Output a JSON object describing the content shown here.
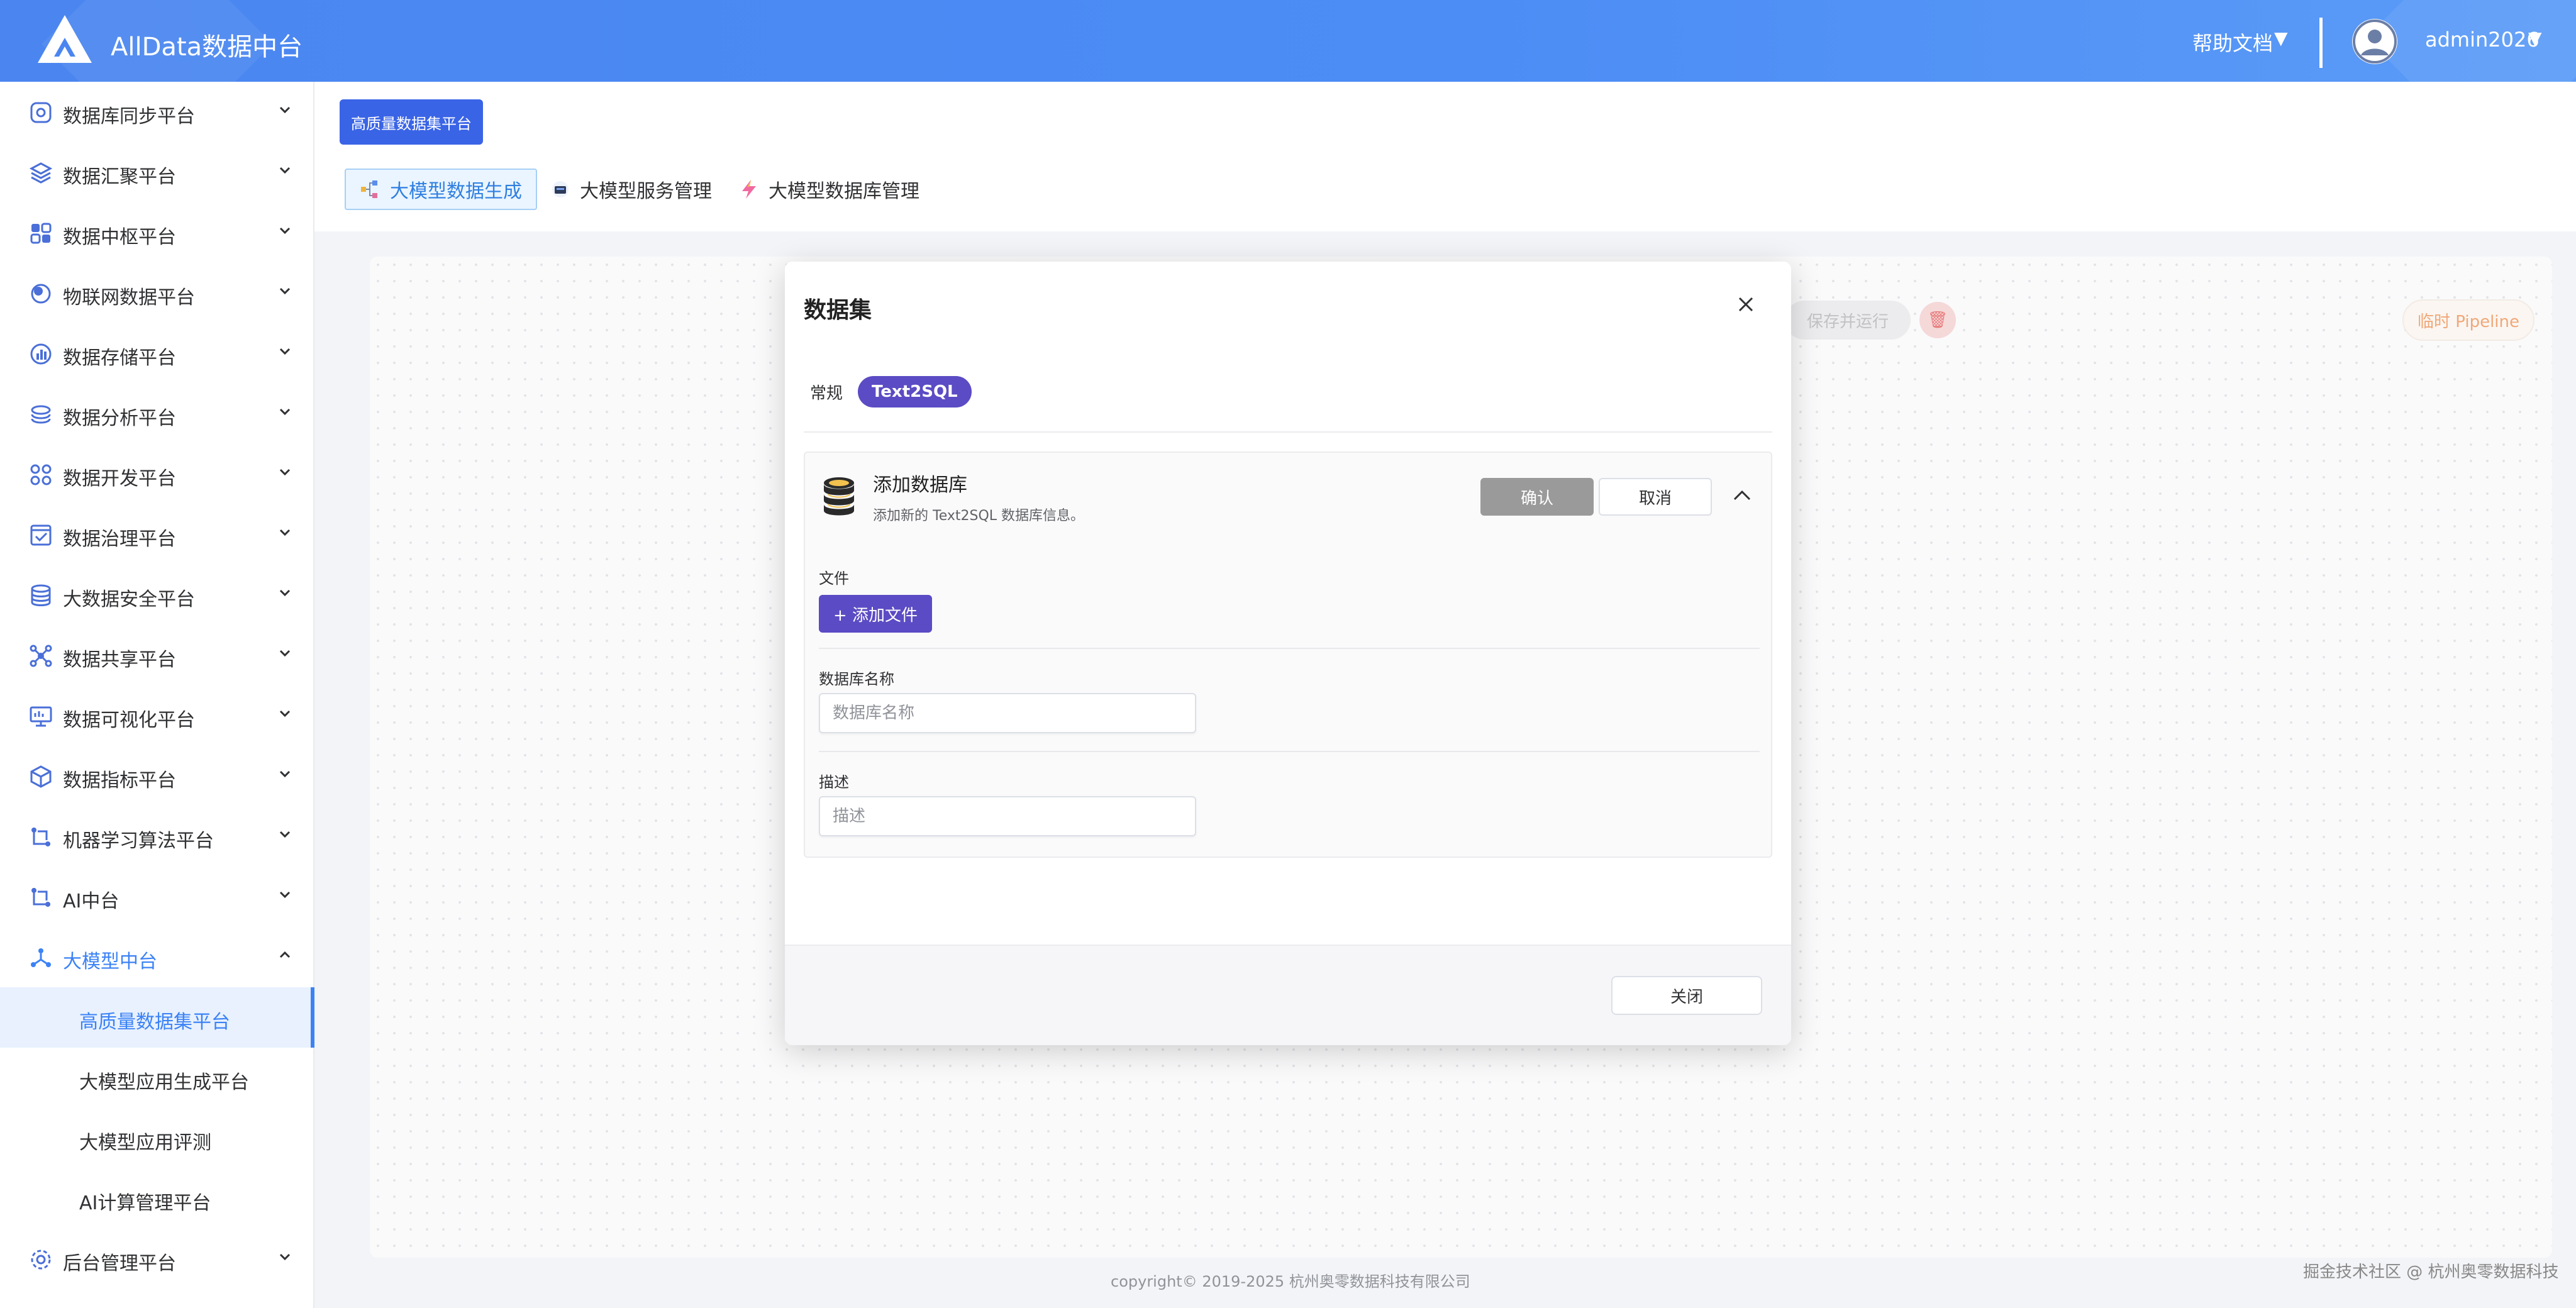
{
  "header": {
    "app_title": "AllData数据中台",
    "help_label": "帮助文档",
    "help_arrow": "▼",
    "username": "admin2026",
    "user_arrow": "▼"
  },
  "sidebar": {
    "items": [
      {
        "label": "数据库同步平台",
        "icon": "db-sync-icon"
      },
      {
        "label": "数据汇聚平台",
        "icon": "layers-icon"
      },
      {
        "label": "数据中枢平台",
        "icon": "grid-icon"
      },
      {
        "label": "物联网数据平台",
        "icon": "iot-icon"
      },
      {
        "label": "数据存储平台",
        "icon": "bar-chart-icon"
      },
      {
        "label": "数据分析平台",
        "icon": "analysis-icon"
      },
      {
        "label": "数据开发平台",
        "icon": "command-icon"
      },
      {
        "label": "数据治理平台",
        "icon": "checklist-icon"
      },
      {
        "label": "大数据安全平台",
        "icon": "database-icon"
      },
      {
        "label": "数据共享平台",
        "icon": "share-icon"
      },
      {
        "label": "数据可视化平台",
        "icon": "monitor-icon"
      },
      {
        "label": "数据指标平台",
        "icon": "cube-icon"
      },
      {
        "label": "机器学习算法平台",
        "icon": "ml-icon"
      },
      {
        "label": "AI中台",
        "icon": "ai-icon"
      },
      {
        "label": "大模型中台",
        "icon": "model-icon"
      }
    ],
    "sub_items": [
      {
        "label": "高质量数据集平台"
      },
      {
        "label": "大模型应用生成平台"
      },
      {
        "label": "大模型应用评测"
      },
      {
        "label": "AI计算管理平台"
      }
    ],
    "bottom_item": {
      "label": "后台管理平台",
      "icon": "settings-icon"
    }
  },
  "topbar": {
    "breadcrumb": "高质量数据集平台",
    "tabs": [
      {
        "label": "大模型数据生成",
        "icon": "flow-icon"
      },
      {
        "label": "大模型服务管理",
        "icon": "server-icon"
      },
      {
        "label": "大模型数据库管理",
        "icon": "lightning-icon"
      }
    ]
  },
  "canvas": {
    "save_run": "保存并运行",
    "trash_glyph": "🗑",
    "pipeline": "临时 Pipeline"
  },
  "modal": {
    "title": "数据集",
    "modes": [
      "常规",
      "Text2SQL"
    ],
    "card": {
      "title": "添加数据库",
      "subtitle": "添加新的 Text2SQL 数据库信息。",
      "confirm": "确认",
      "cancel": "取消",
      "file_label": "文件",
      "add_file": "+ 添加文件",
      "db_name_label": "数据库名称",
      "db_name_placeholder": "数据库名称",
      "desc_label": "描述",
      "desc_placeholder": "描述"
    },
    "close": "关闭"
  },
  "footer": {
    "copyright": "copyright© 2019-2025 杭州奥零数据科技有限公司",
    "watermark": "掘金技术社区 @ 杭州奥零数据科技"
  },
  "colors": {
    "header": "#4b86f0",
    "accent": "#3b82f6",
    "primary_purple": "#5b4bc4",
    "confirm_gray": "#9a9a9a"
  }
}
